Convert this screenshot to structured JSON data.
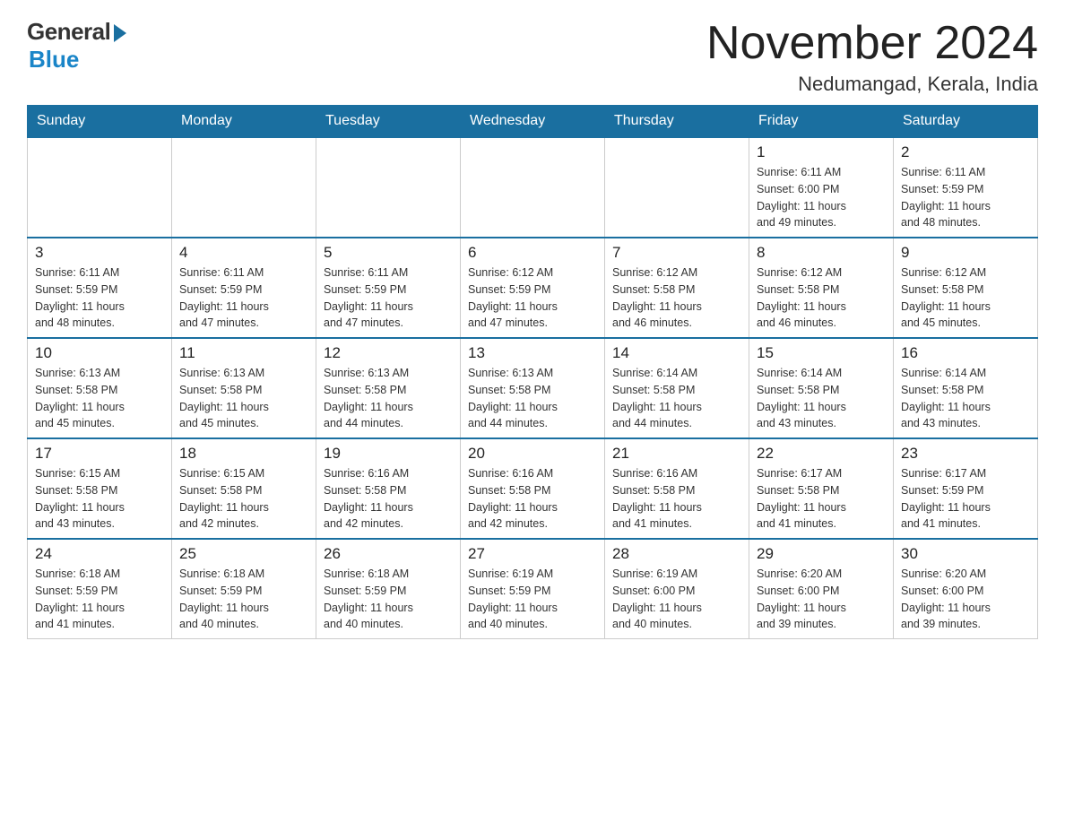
{
  "header": {
    "logo_general": "General",
    "logo_blue": "Blue",
    "month_title": "November 2024",
    "location": "Nedumangad, Kerala, India"
  },
  "weekdays": [
    "Sunday",
    "Monday",
    "Tuesday",
    "Wednesday",
    "Thursday",
    "Friday",
    "Saturday"
  ],
  "weeks": [
    {
      "days": [
        {
          "date": "",
          "info": "",
          "empty": true
        },
        {
          "date": "",
          "info": "",
          "empty": true
        },
        {
          "date": "",
          "info": "",
          "empty": true
        },
        {
          "date": "",
          "info": "",
          "empty": true
        },
        {
          "date": "",
          "info": "",
          "empty": true
        },
        {
          "date": "1",
          "info": "Sunrise: 6:11 AM\nSunset: 6:00 PM\nDaylight: 11 hours\nand 49 minutes."
        },
        {
          "date": "2",
          "info": "Sunrise: 6:11 AM\nSunset: 5:59 PM\nDaylight: 11 hours\nand 48 minutes."
        }
      ]
    },
    {
      "days": [
        {
          "date": "3",
          "info": "Sunrise: 6:11 AM\nSunset: 5:59 PM\nDaylight: 11 hours\nand 48 minutes."
        },
        {
          "date": "4",
          "info": "Sunrise: 6:11 AM\nSunset: 5:59 PM\nDaylight: 11 hours\nand 47 minutes."
        },
        {
          "date": "5",
          "info": "Sunrise: 6:11 AM\nSunset: 5:59 PM\nDaylight: 11 hours\nand 47 minutes."
        },
        {
          "date": "6",
          "info": "Sunrise: 6:12 AM\nSunset: 5:59 PM\nDaylight: 11 hours\nand 47 minutes."
        },
        {
          "date": "7",
          "info": "Sunrise: 6:12 AM\nSunset: 5:58 PM\nDaylight: 11 hours\nand 46 minutes."
        },
        {
          "date": "8",
          "info": "Sunrise: 6:12 AM\nSunset: 5:58 PM\nDaylight: 11 hours\nand 46 minutes."
        },
        {
          "date": "9",
          "info": "Sunrise: 6:12 AM\nSunset: 5:58 PM\nDaylight: 11 hours\nand 45 minutes."
        }
      ]
    },
    {
      "days": [
        {
          "date": "10",
          "info": "Sunrise: 6:13 AM\nSunset: 5:58 PM\nDaylight: 11 hours\nand 45 minutes."
        },
        {
          "date": "11",
          "info": "Sunrise: 6:13 AM\nSunset: 5:58 PM\nDaylight: 11 hours\nand 45 minutes."
        },
        {
          "date": "12",
          "info": "Sunrise: 6:13 AM\nSunset: 5:58 PM\nDaylight: 11 hours\nand 44 minutes."
        },
        {
          "date": "13",
          "info": "Sunrise: 6:13 AM\nSunset: 5:58 PM\nDaylight: 11 hours\nand 44 minutes."
        },
        {
          "date": "14",
          "info": "Sunrise: 6:14 AM\nSunset: 5:58 PM\nDaylight: 11 hours\nand 44 minutes."
        },
        {
          "date": "15",
          "info": "Sunrise: 6:14 AM\nSunset: 5:58 PM\nDaylight: 11 hours\nand 43 minutes."
        },
        {
          "date": "16",
          "info": "Sunrise: 6:14 AM\nSunset: 5:58 PM\nDaylight: 11 hours\nand 43 minutes."
        }
      ]
    },
    {
      "days": [
        {
          "date": "17",
          "info": "Sunrise: 6:15 AM\nSunset: 5:58 PM\nDaylight: 11 hours\nand 43 minutes."
        },
        {
          "date": "18",
          "info": "Sunrise: 6:15 AM\nSunset: 5:58 PM\nDaylight: 11 hours\nand 42 minutes."
        },
        {
          "date": "19",
          "info": "Sunrise: 6:16 AM\nSunset: 5:58 PM\nDaylight: 11 hours\nand 42 minutes."
        },
        {
          "date": "20",
          "info": "Sunrise: 6:16 AM\nSunset: 5:58 PM\nDaylight: 11 hours\nand 42 minutes."
        },
        {
          "date": "21",
          "info": "Sunrise: 6:16 AM\nSunset: 5:58 PM\nDaylight: 11 hours\nand 41 minutes."
        },
        {
          "date": "22",
          "info": "Sunrise: 6:17 AM\nSunset: 5:58 PM\nDaylight: 11 hours\nand 41 minutes."
        },
        {
          "date": "23",
          "info": "Sunrise: 6:17 AM\nSunset: 5:59 PM\nDaylight: 11 hours\nand 41 minutes."
        }
      ]
    },
    {
      "days": [
        {
          "date": "24",
          "info": "Sunrise: 6:18 AM\nSunset: 5:59 PM\nDaylight: 11 hours\nand 41 minutes."
        },
        {
          "date": "25",
          "info": "Sunrise: 6:18 AM\nSunset: 5:59 PM\nDaylight: 11 hours\nand 40 minutes."
        },
        {
          "date": "26",
          "info": "Sunrise: 6:18 AM\nSunset: 5:59 PM\nDaylight: 11 hours\nand 40 minutes."
        },
        {
          "date": "27",
          "info": "Sunrise: 6:19 AM\nSunset: 5:59 PM\nDaylight: 11 hours\nand 40 minutes."
        },
        {
          "date": "28",
          "info": "Sunrise: 6:19 AM\nSunset: 6:00 PM\nDaylight: 11 hours\nand 40 minutes."
        },
        {
          "date": "29",
          "info": "Sunrise: 6:20 AM\nSunset: 6:00 PM\nDaylight: 11 hours\nand 39 minutes."
        },
        {
          "date": "30",
          "info": "Sunrise: 6:20 AM\nSunset: 6:00 PM\nDaylight: 11 hours\nand 39 minutes."
        }
      ]
    }
  ]
}
